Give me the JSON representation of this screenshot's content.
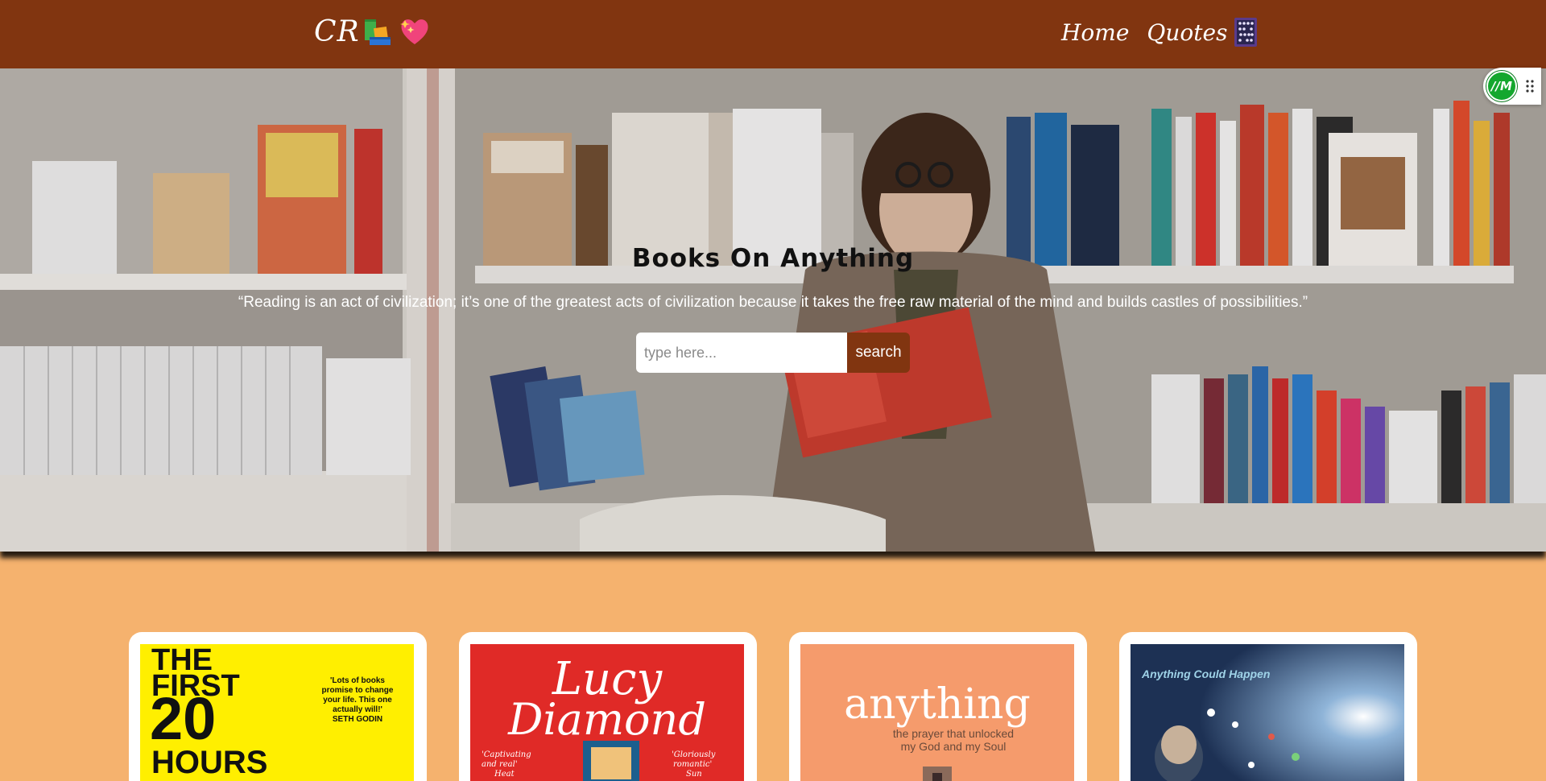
{
  "navbar": {
    "brand_text": "CR",
    "brand_icons": [
      "books-icon",
      "sparkling-heart-icon"
    ],
    "links": [
      {
        "label": "Home"
      },
      {
        "label": "Quotes"
      }
    ],
    "quotes_icon": "abacus-icon",
    "color": "#813510"
  },
  "hero": {
    "title": "Books On Anything",
    "quote": "“Reading is an act of civilization; it’s one of the greatest acts of civilization because it takes the free raw material of the mind and builds castles of possibilities.”",
    "search": {
      "placeholder": "type here...",
      "value": "",
      "button_label": "search"
    }
  },
  "extension": {
    "badge_text": "//M"
  },
  "cards": [
    {
      "cover_lines": [
        "THE",
        "FIRST",
        "20",
        "HOURS"
      ],
      "blurb": [
        "'Lots of books",
        "promise to change",
        "your life. This one",
        "actually will!'",
        "SETH GODIN"
      ],
      "color": "#ffef00"
    },
    {
      "cover_lines": [
        "Lucy",
        "Diamond"
      ],
      "quotes": [
        "'Captivating",
        "and real'",
        "Heat",
        "'Gloriously",
        "romantic'",
        "Sun"
      ],
      "color": "#e02a27"
    },
    {
      "cover_lines": [
        "anything"
      ],
      "subtitle": [
        "the prayer that unlocked",
        "my God and my Soul"
      ],
      "color": "#f59b6c"
    },
    {
      "cover_lines": [
        "Anything Could Happen"
      ],
      "color": "#1d3154"
    }
  ],
  "page_background": "#f5b26e"
}
